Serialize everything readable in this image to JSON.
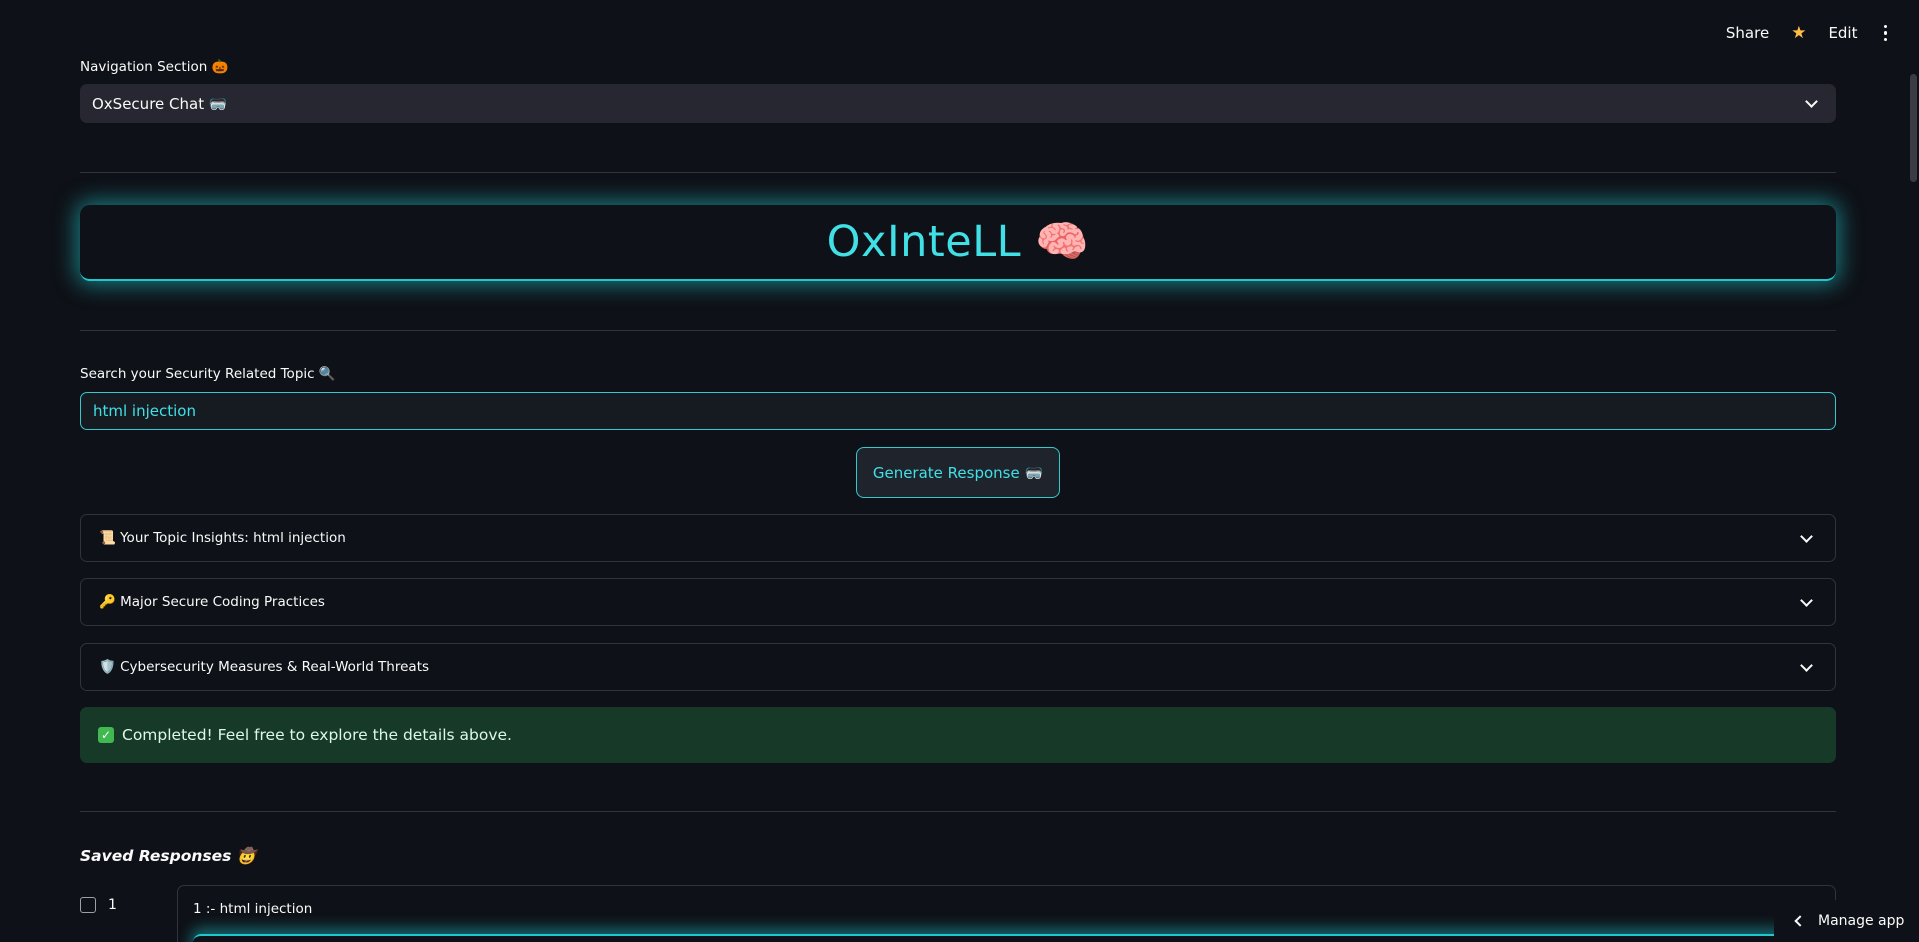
{
  "toolbar": {
    "share": "Share",
    "star_icon": "star-icon",
    "edit": "Edit",
    "menu_icon": "kebab-menu-icon"
  },
  "navigation": {
    "label": "Navigation Section 🎃",
    "selected": "OxSecure Chat 🥽"
  },
  "banner": {
    "title": "OxInteLL 🧠"
  },
  "search": {
    "label": "Search your Security Related Topic 🔍",
    "value": "html injection"
  },
  "generate_button": "Generate Response 🥽",
  "expanders": [
    {
      "label": "📜 Your Topic Insights: html injection"
    },
    {
      "label": "🔑 Major Secure Coding Practices"
    },
    {
      "label": "🛡️ Cybersecurity Measures & Real-World Threats"
    }
  ],
  "success_message": "Completed! Feel free to explore the details above.",
  "saved": {
    "title": "Saved Responses 🤠",
    "items": [
      {
        "checkbox_label": "1",
        "title": "1 :- html injection"
      }
    ]
  },
  "manage_app": "Manage app",
  "colors": {
    "background": "#0e1117",
    "accent": "#41e0e6",
    "success_bg": "#173928",
    "star": "#ffbd45"
  }
}
